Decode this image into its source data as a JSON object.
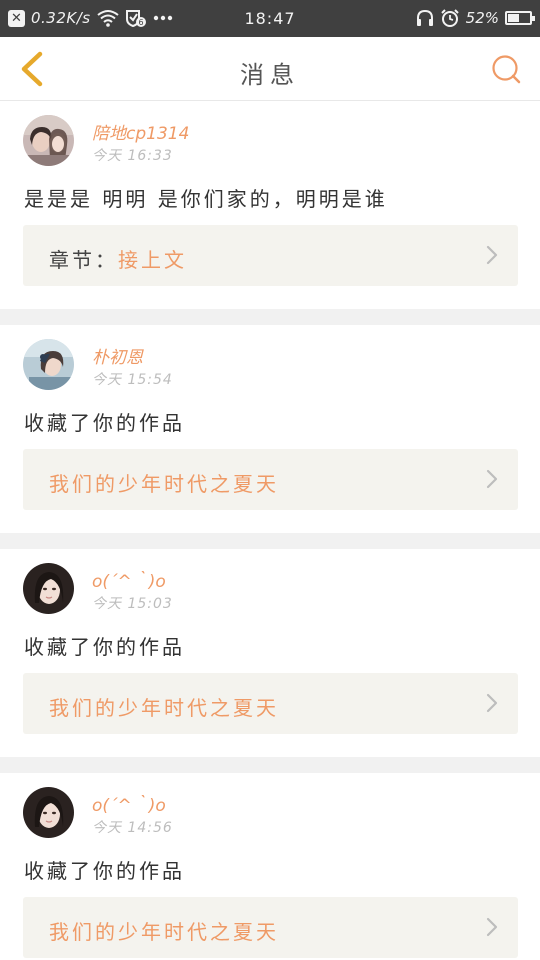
{
  "status_bar": {
    "close_glyph": "✕",
    "net_speed": "0.32K/s",
    "time": "18:47",
    "battery_percent": "52%",
    "battery_level": 0.52,
    "icons": [
      "wifi-icon",
      "sync-badge-icon",
      "more-dots-icon",
      "headphones-icon",
      "alarm-clock-icon",
      "battery-icon"
    ]
  },
  "nav": {
    "title": "消息",
    "back_icon": "chevron-left-icon",
    "search_icon": "search-icon",
    "accent": "#ef9a66",
    "back_color": "#e6a92c"
  },
  "messages": [
    {
      "username": "陪地cp1314",
      "time": "今天 16:33",
      "content": "是是是  明明  是你们家的，明明是谁",
      "ref_label": "章节：",
      "ref_value": "接上文"
    },
    {
      "username": "朴初恩",
      "time": "今天 15:54",
      "content": "收藏了你的作品",
      "ref_label": "",
      "ref_value": "我们的少年时代之夏天"
    },
    {
      "username": "o(´^｀)o",
      "time": "今天 15:03",
      "content": "收藏了你的作品",
      "ref_label": "",
      "ref_value": "我们的少年时代之夏天"
    },
    {
      "username": "o(´^｀)o",
      "time": "今天 14:56",
      "content": "收藏了你的作品",
      "ref_label": "",
      "ref_value": "我们的少年时代之夏天"
    }
  ]
}
